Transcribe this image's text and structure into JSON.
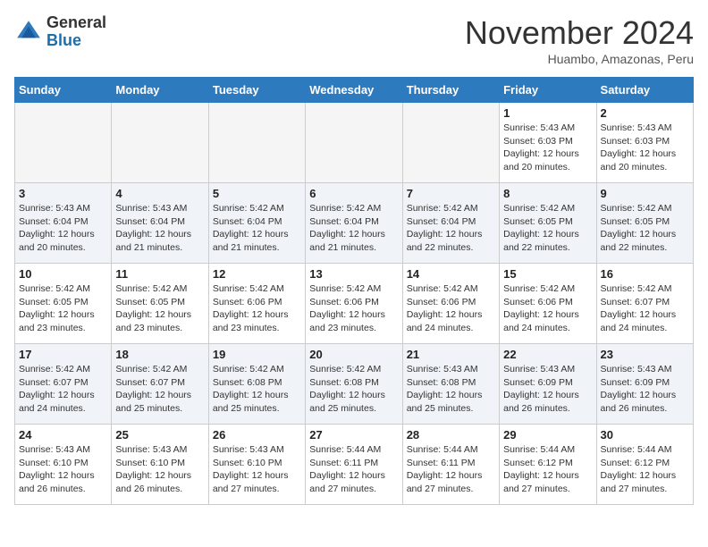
{
  "header": {
    "logo_line1": "General",
    "logo_line2": "Blue",
    "month_title": "November 2024",
    "subtitle": "Huambo, Amazonas, Peru"
  },
  "weekdays": [
    "Sunday",
    "Monday",
    "Tuesday",
    "Wednesday",
    "Thursday",
    "Friday",
    "Saturday"
  ],
  "weeks": [
    [
      {
        "day": "",
        "info": ""
      },
      {
        "day": "",
        "info": ""
      },
      {
        "day": "",
        "info": ""
      },
      {
        "day": "",
        "info": ""
      },
      {
        "day": "",
        "info": ""
      },
      {
        "day": "1",
        "info": "Sunrise: 5:43 AM\nSunset: 6:03 PM\nDaylight: 12 hours and 20 minutes."
      },
      {
        "day": "2",
        "info": "Sunrise: 5:43 AM\nSunset: 6:03 PM\nDaylight: 12 hours and 20 minutes."
      }
    ],
    [
      {
        "day": "3",
        "info": "Sunrise: 5:43 AM\nSunset: 6:04 PM\nDaylight: 12 hours and 20 minutes."
      },
      {
        "day": "4",
        "info": "Sunrise: 5:43 AM\nSunset: 6:04 PM\nDaylight: 12 hours and 21 minutes."
      },
      {
        "day": "5",
        "info": "Sunrise: 5:42 AM\nSunset: 6:04 PM\nDaylight: 12 hours and 21 minutes."
      },
      {
        "day": "6",
        "info": "Sunrise: 5:42 AM\nSunset: 6:04 PM\nDaylight: 12 hours and 21 minutes."
      },
      {
        "day": "7",
        "info": "Sunrise: 5:42 AM\nSunset: 6:04 PM\nDaylight: 12 hours and 22 minutes."
      },
      {
        "day": "8",
        "info": "Sunrise: 5:42 AM\nSunset: 6:05 PM\nDaylight: 12 hours and 22 minutes."
      },
      {
        "day": "9",
        "info": "Sunrise: 5:42 AM\nSunset: 6:05 PM\nDaylight: 12 hours and 22 minutes."
      }
    ],
    [
      {
        "day": "10",
        "info": "Sunrise: 5:42 AM\nSunset: 6:05 PM\nDaylight: 12 hours and 23 minutes."
      },
      {
        "day": "11",
        "info": "Sunrise: 5:42 AM\nSunset: 6:05 PM\nDaylight: 12 hours and 23 minutes."
      },
      {
        "day": "12",
        "info": "Sunrise: 5:42 AM\nSunset: 6:06 PM\nDaylight: 12 hours and 23 minutes."
      },
      {
        "day": "13",
        "info": "Sunrise: 5:42 AM\nSunset: 6:06 PM\nDaylight: 12 hours and 23 minutes."
      },
      {
        "day": "14",
        "info": "Sunrise: 5:42 AM\nSunset: 6:06 PM\nDaylight: 12 hours and 24 minutes."
      },
      {
        "day": "15",
        "info": "Sunrise: 5:42 AM\nSunset: 6:06 PM\nDaylight: 12 hours and 24 minutes."
      },
      {
        "day": "16",
        "info": "Sunrise: 5:42 AM\nSunset: 6:07 PM\nDaylight: 12 hours and 24 minutes."
      }
    ],
    [
      {
        "day": "17",
        "info": "Sunrise: 5:42 AM\nSunset: 6:07 PM\nDaylight: 12 hours and 24 minutes."
      },
      {
        "day": "18",
        "info": "Sunrise: 5:42 AM\nSunset: 6:07 PM\nDaylight: 12 hours and 25 minutes."
      },
      {
        "day": "19",
        "info": "Sunrise: 5:42 AM\nSunset: 6:08 PM\nDaylight: 12 hours and 25 minutes."
      },
      {
        "day": "20",
        "info": "Sunrise: 5:42 AM\nSunset: 6:08 PM\nDaylight: 12 hours and 25 minutes."
      },
      {
        "day": "21",
        "info": "Sunrise: 5:43 AM\nSunset: 6:08 PM\nDaylight: 12 hours and 25 minutes."
      },
      {
        "day": "22",
        "info": "Sunrise: 5:43 AM\nSunset: 6:09 PM\nDaylight: 12 hours and 26 minutes."
      },
      {
        "day": "23",
        "info": "Sunrise: 5:43 AM\nSunset: 6:09 PM\nDaylight: 12 hours and 26 minutes."
      }
    ],
    [
      {
        "day": "24",
        "info": "Sunrise: 5:43 AM\nSunset: 6:10 PM\nDaylight: 12 hours and 26 minutes."
      },
      {
        "day": "25",
        "info": "Sunrise: 5:43 AM\nSunset: 6:10 PM\nDaylight: 12 hours and 26 minutes."
      },
      {
        "day": "26",
        "info": "Sunrise: 5:43 AM\nSunset: 6:10 PM\nDaylight: 12 hours and 27 minutes."
      },
      {
        "day": "27",
        "info": "Sunrise: 5:44 AM\nSunset: 6:11 PM\nDaylight: 12 hours and 27 minutes."
      },
      {
        "day": "28",
        "info": "Sunrise: 5:44 AM\nSunset: 6:11 PM\nDaylight: 12 hours and 27 minutes."
      },
      {
        "day": "29",
        "info": "Sunrise: 5:44 AM\nSunset: 6:12 PM\nDaylight: 12 hours and 27 minutes."
      },
      {
        "day": "30",
        "info": "Sunrise: 5:44 AM\nSunset: 6:12 PM\nDaylight: 12 hours and 27 minutes."
      }
    ]
  ]
}
